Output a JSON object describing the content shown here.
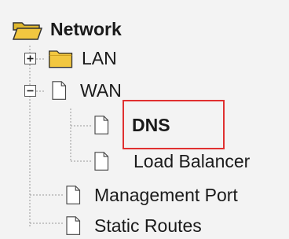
{
  "tree": {
    "root": {
      "label": "Network"
    },
    "items": [
      {
        "label": "LAN",
        "expanded": false
      },
      {
        "label": "WAN",
        "expanded": true,
        "children": [
          {
            "label": "DNS",
            "selected": true
          },
          {
            "label": "Load Balancer"
          }
        ]
      },
      {
        "label": "Management Port"
      },
      {
        "label": "Static Routes"
      }
    ]
  },
  "colors": {
    "folder": "#f2c740",
    "highlight_border": "#e03030",
    "background": "#f3f3f3"
  }
}
